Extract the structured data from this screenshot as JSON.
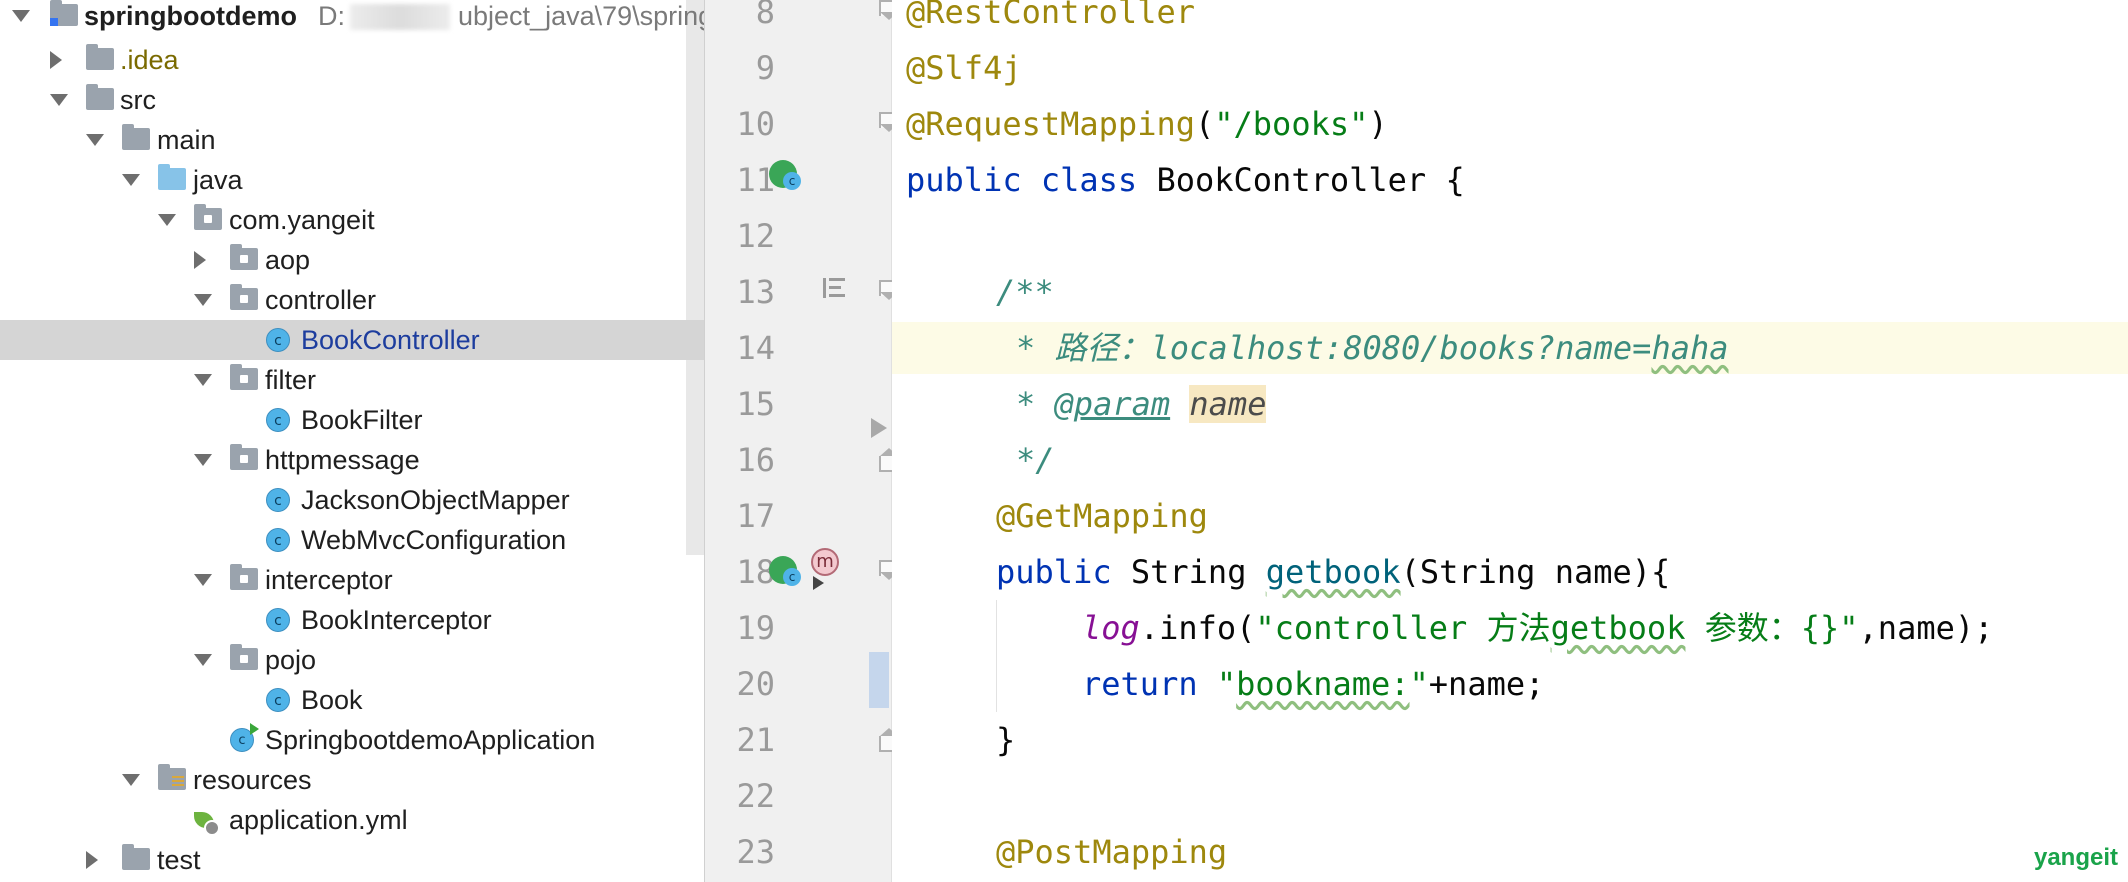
{
  "project_tree": {
    "root": {
      "name": "springbootdemo",
      "path_prefix": "D:",
      "path_suffix": "ubject_java\\79\\spring"
    },
    "items": [
      {
        "label": ".idea"
      },
      {
        "label": "src"
      },
      {
        "label": "main"
      },
      {
        "label": "java"
      },
      {
        "label": "com.yangeit"
      },
      {
        "label": "aop"
      },
      {
        "label": "controller"
      },
      {
        "label": "BookController"
      },
      {
        "label": "filter"
      },
      {
        "label": "BookFilter"
      },
      {
        "label": "httpmessage"
      },
      {
        "label": "JacksonObjectMapper"
      },
      {
        "label": "WebMvcConfiguration"
      },
      {
        "label": "interceptor"
      },
      {
        "label": "BookInterceptor"
      },
      {
        "label": "pojo"
      },
      {
        "label": "Book"
      },
      {
        "label": "SpringbootdemoApplication"
      },
      {
        "label": "resources"
      },
      {
        "label": "application.yml"
      },
      {
        "label": "test"
      }
    ]
  },
  "gutter": {
    "line_numbers": [
      "8",
      "9",
      "10",
      "11",
      "12",
      "13",
      "14",
      "15",
      "16",
      "17",
      "18",
      "19",
      "20",
      "21",
      "22",
      "23"
    ],
    "class_icon_letter": "c",
    "method_icon_letter": "m"
  },
  "editor": {
    "lines": {
      "l8_ann": "@RestController",
      "l9_ann": "@Slf4j",
      "l10_ann": "@RequestMapping",
      "l10_open": "(",
      "l10_str": "\"/books\"",
      "l10_close": ")",
      "l11_kw1": "public",
      "l11_kw2": "class",
      "l11_rest": "BookController {",
      "l13_doc": "/**",
      "l14_star": "* ",
      "l14_text": "路径：localhost:8080/books?name=",
      "l14_haha": "haha",
      "l15_star": "* ",
      "l15_tag": "@param",
      "l15_name": "name",
      "l16_doc": "*/",
      "l17_ann": "@GetMapping",
      "l18_kw": "public",
      "l18_type": "String",
      "l18_meth": "getbook",
      "l18_rest": "(String name){",
      "l19_log": "log",
      "l19_info": ".info(",
      "l19_str1": "\"controller 方法",
      "l19_str2": "getbook",
      "l19_str3": " 参数：{}\"",
      "l19_end": ",name);",
      "l20_kw": "return",
      "l20_q1": "\"",
      "l20_str": "bookname:",
      "l20_q2": "\"",
      "l20_rest": "+name;",
      "l21_brace": "}",
      "l23_ann": "@PostMapping"
    }
  },
  "watermark": "yangeit",
  "colors": {
    "annotation": "#9e880d",
    "keyword": "#0033b3",
    "string": "#067d17",
    "doc": "#3c8c7e",
    "selection": "#d5d5d5",
    "gutter_bg": "#f0f0f0"
  }
}
